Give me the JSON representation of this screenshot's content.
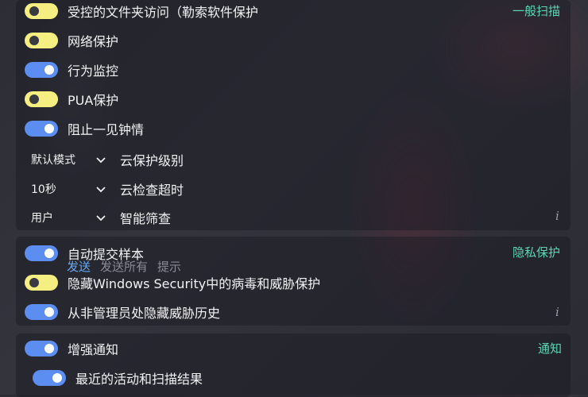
{
  "section1": {
    "title": "一般扫描",
    "toggles": [
      {
        "label": "受控的文件夹访问（勒索软件保护",
        "on": false
      },
      {
        "label": "网络保护",
        "on": false
      },
      {
        "label": "行为监控",
        "on": true
      },
      {
        "label": "PUA保护",
        "on": false
      },
      {
        "label": "阻止一见钟情",
        "on": true
      }
    ],
    "selects": [
      {
        "value": "默认模式",
        "label": "云保护级别"
      },
      {
        "value": "10秒",
        "label": "云检查超时"
      },
      {
        "value": "用户",
        "label": "智能筛查"
      }
    ],
    "info": "i"
  },
  "section2": {
    "title": "隐私保护",
    "toggles": [
      {
        "label": "自动提交样本",
        "on": true
      },
      {
        "label": "隐藏Windows Security中的病毒和威胁保护",
        "on": false
      },
      {
        "label": "从非管理员处隐藏威胁历史",
        "on": true
      }
    ],
    "tabs": [
      "发送",
      "发送所有",
      "提示"
    ],
    "info": "i"
  },
  "section3": {
    "title": "通知",
    "toggles": [
      {
        "label": "增强通知",
        "on": true
      },
      {
        "label": "最近的活动和扫描结果",
        "on": true
      }
    ]
  },
  "colors": {
    "accent": "#5ed6b5",
    "toggle_on": "#5b8ef0",
    "toggle_off": "#f5ee80",
    "link": "#6aa8f0"
  }
}
